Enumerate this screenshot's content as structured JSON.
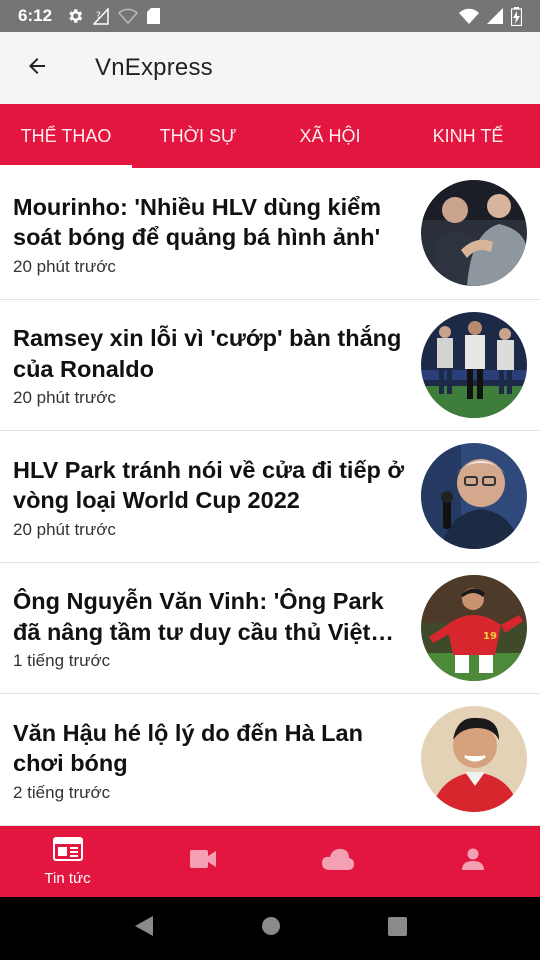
{
  "status_bar": {
    "time": "6:12",
    "left_icons": [
      "settings-icon",
      "no-signal-icon",
      "wifi-weak-icon",
      "sd-card-icon"
    ],
    "right_icons": [
      "wifi-icon",
      "cell-signal-icon",
      "battery-charging-icon"
    ]
  },
  "app_bar": {
    "title": "VnExpress",
    "back_icon": "arrow-back-icon"
  },
  "tabs": [
    {
      "label": "THỂ THAO",
      "active": true
    },
    {
      "label": "THỜI SỰ",
      "active": false
    },
    {
      "label": "XÃ HỘI",
      "active": false
    },
    {
      "label": "KINH TẾ",
      "active": false
    }
  ],
  "news": [
    {
      "title": "Mourinho: 'Nhiều HLV dùng kiểm soát bóng để quảng bá hình ảnh'",
      "time": "20 phút trước"
    },
    {
      "title": "Ramsey xin lỗi vì 'cướp' bàn thắng của Ronaldo",
      "time": "20 phút trước"
    },
    {
      "title": "HLV Park tránh nói về cửa đi tiếp ở vòng loại World Cup 2022",
      "time": "20 phút trước"
    },
    {
      "title": "Ông Nguyễn Văn Vinh: 'Ông Park đã nâng tầm tư duy cầu thủ Việt Nam'",
      "time": "1 tiếng trước"
    },
    {
      "title": "Văn Hậu hé lộ lý do đến Hà Lan chơi bóng",
      "time": "2 tiếng trước"
    }
  ],
  "bottom_nav": [
    {
      "label": "Tin tức",
      "icon": "newspaper-icon",
      "active": true
    },
    {
      "label": "",
      "icon": "video-camera-icon",
      "active": false
    },
    {
      "label": "",
      "icon": "cloud-icon",
      "active": false
    },
    {
      "label": "",
      "icon": "person-icon",
      "active": false
    }
  ],
  "colors": {
    "accent": "#e2163f",
    "status_bar": "#757575",
    "app_bar": "#f5f5f5"
  }
}
